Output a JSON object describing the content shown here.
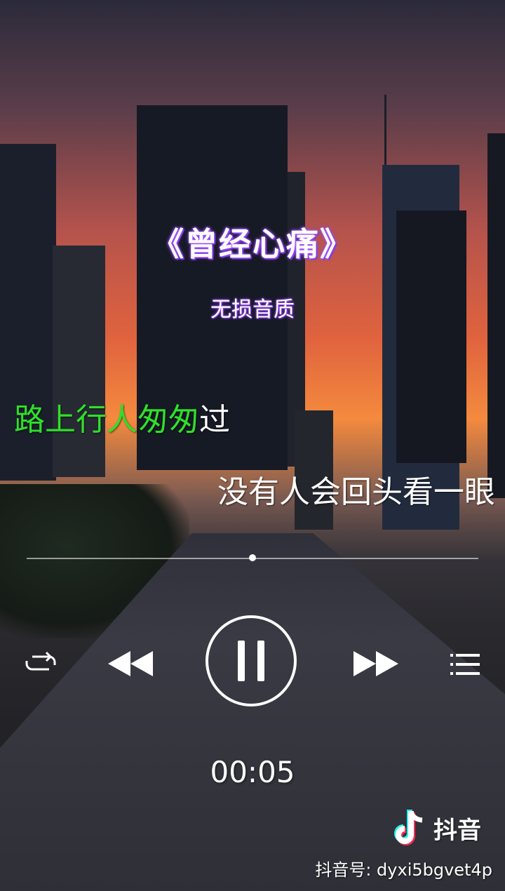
{
  "song": {
    "title": "《曾经心痛》",
    "quality": "无损音质"
  },
  "lyrics": {
    "current_sung": "路上行人匆匆",
    "current_rest": "过",
    "next": "没有人会回头看一眼"
  },
  "player": {
    "progress_fraction": 0.5,
    "elapsed": "00:05",
    "state": "playing",
    "icons": [
      "repeat-icon",
      "previous-icon",
      "pause-icon",
      "next-icon",
      "playlist-icon"
    ]
  },
  "watermark": {
    "app_name": "抖音",
    "account": "抖音号: dyxi5bgvet4p"
  },
  "colors": {
    "sung_lyric": "#2fe02a",
    "title_glow": "#8a3dff"
  }
}
